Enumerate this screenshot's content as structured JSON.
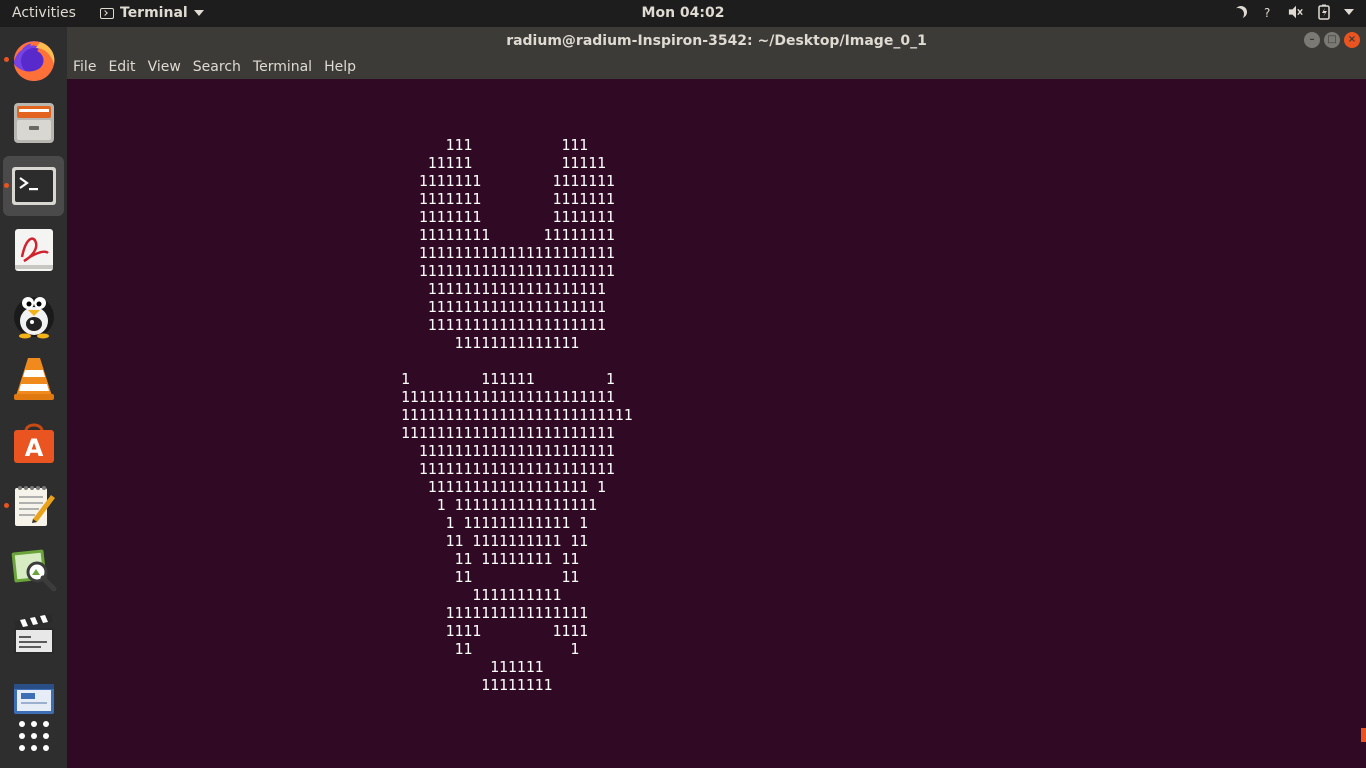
{
  "top_panel": {
    "activities_label": "Activities",
    "app_menu_label": "Terminal",
    "clock": "Mon 04:02",
    "status_icons": [
      "night-light-icon",
      "help-icon",
      "volume-muted-icon",
      "battery-icon",
      "system-menu-caret-icon"
    ]
  },
  "dock": {
    "items": [
      {
        "name": "firefox-icon",
        "running": true
      },
      {
        "name": "files-icon",
        "running": false
      },
      {
        "name": "terminal-icon",
        "running": true,
        "active": true
      },
      {
        "name": "document-viewer-icon",
        "running": false
      },
      {
        "name": "penguin-game-icon",
        "running": false
      },
      {
        "name": "vlc-icon",
        "running": false
      },
      {
        "name": "software-center-icon",
        "running": false
      },
      {
        "name": "text-editor-icon",
        "running": true
      },
      {
        "name": "image-viewer-icon",
        "running": false
      },
      {
        "name": "video-editor-icon",
        "running": false
      },
      {
        "name": "screenshot-icon",
        "running": false
      },
      {
        "name": "show-applications-icon",
        "running": false
      }
    ]
  },
  "window": {
    "title": "radium@radium-Inspiron-3542: ~/Desktop/Image_0_1",
    "menu": [
      "File",
      "Edit",
      "View",
      "Search",
      "Terminal",
      "Help"
    ],
    "controls": {
      "minimize": "–",
      "maximize": "□",
      "close": "×"
    }
  },
  "terminal": {
    "lines": [
      "     111          111",
      "   11111          11111",
      "  1111111        1111111",
      "  1111111        1111111",
      "  1111111        1111111",
      "  11111111      11111111",
      "  1111111111111111111111",
      "  1111111111111111111111",
      "   11111111111111111111",
      "   11111111111111111111",
      "   11111111111111111111",
      "      11111111111111",
      "",
      "1        111111        1",
      "111111111111111111111111",
      "11111111111111111111111111",
      "111111111111111111111111",
      "  1111111111111111111111",
      "  1111111111111111111111",
      "   111111111111111111 1",
      "    1 1111111111111111",
      "     1 111111111111 1",
      "     11 1111111111 11",
      "      11 11111111 11",
      "      11          11",
      "        1111111111",
      "     1111111111111111",
      "     1111        1111",
      "      11           1",
      "          111111",
      "         11111111"
    ]
  }
}
